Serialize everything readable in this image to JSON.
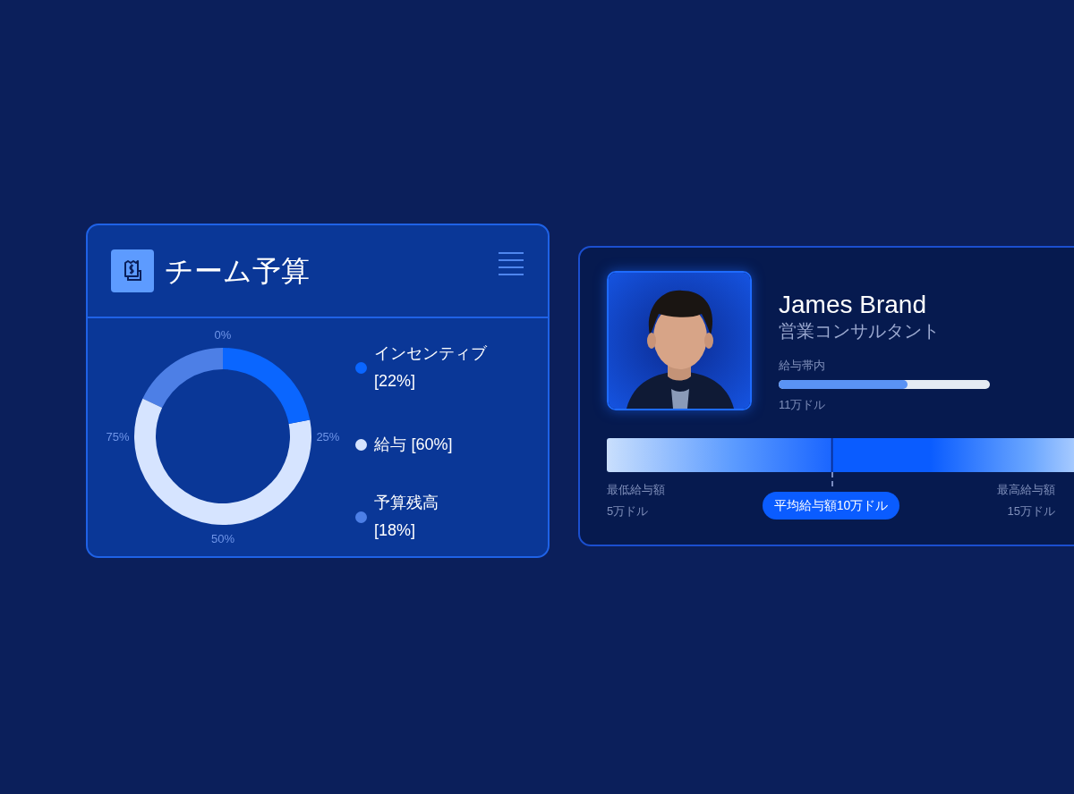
{
  "budget_card": {
    "title": "チーム予算",
    "chart_data": {
      "type": "donut",
      "categories": [
        "インセンティブ",
        "給与",
        "予算残高"
      ],
      "values": [
        22,
        60,
        18
      ],
      "value_labels": [
        "[22%]",
        "[60%]",
        "[18%]"
      ],
      "colors": [
        "#0a66ff",
        "#d6e4ff",
        "#4d7fe6"
      ],
      "annotations": [
        "0%",
        "25%",
        "50%",
        "75%"
      ]
    }
  },
  "profile_card": {
    "name": "James Brand",
    "role": "営業コンサルタント",
    "band": {
      "label": "給与帯内",
      "level": 0.61,
      "reading": "11万ドル"
    },
    "range": {
      "min_label": "最低給与額",
      "min_value": "5万ドル",
      "average": "平均給与額10万ドル",
      "max_label": "最高給与額",
      "max_value": "15万ドル"
    }
  }
}
